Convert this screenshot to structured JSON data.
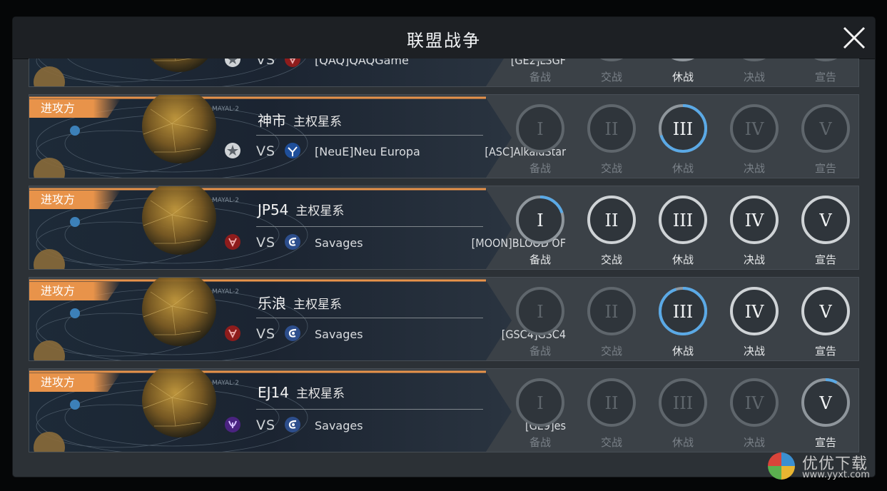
{
  "header": {
    "title": "联盟战争"
  },
  "stage_colors": {
    "dim": "#5f666c",
    "lit": "#cfd3d6",
    "progress": "#5aa9e6",
    "banner": "#e8934a"
  },
  "partial_row": {
    "alliance_a": "[GE2]LSGF",
    "vs": "VS",
    "alliance_b": "[QAQ]QAQGame",
    "stages": [
      {
        "label": "备战",
        "lit": false
      },
      {
        "label": "交战",
        "lit": false
      },
      {
        "label": "休战",
        "lit": true
      },
      {
        "label": "决战",
        "lit": false
      },
      {
        "label": "宣告",
        "lit": false
      }
    ]
  },
  "rows": [
    {
      "tag": "进攻方",
      "system_name": "神市",
      "system_type": "主权星系",
      "alliance_a": "[ASC]AlkaidStar",
      "emblem_a": "star-emblem-icon",
      "vs": "VS",
      "alliance_b": "[NeuE]Neu Europa",
      "emblem_b": "blue-emblem-icon",
      "current_stage": 3,
      "stage_progress": 0.7,
      "stages": [
        {
          "numeral": "I",
          "label": "备战",
          "lit": false
        },
        {
          "numeral": "II",
          "label": "交战",
          "lit": false
        },
        {
          "numeral": "III",
          "label": "休战",
          "lit": true
        },
        {
          "numeral": "IV",
          "label": "决战",
          "lit": false
        },
        {
          "numeral": "V",
          "label": "宣告",
          "lit": false
        }
      ]
    },
    {
      "tag": "进攻方",
      "system_name": "JP54",
      "system_type": "主权星系",
      "alliance_a": "[MOON]BLOOD OF",
      "emblem_a": "red-emblem-icon",
      "vs": "VS",
      "alliance_b": "Savages",
      "emblem_b": "savages-emblem-icon",
      "current_stage": 1,
      "stage_progress": 0.2,
      "stages": [
        {
          "numeral": "I",
          "label": "备战",
          "lit": false
        },
        {
          "numeral": "II",
          "label": "交战",
          "lit": true
        },
        {
          "numeral": "III",
          "label": "休战",
          "lit": true
        },
        {
          "numeral": "IV",
          "label": "决战",
          "lit": true
        },
        {
          "numeral": "V",
          "label": "宣告",
          "lit": true
        }
      ]
    },
    {
      "tag": "进攻方",
      "system_name": "乐浪",
      "system_type": "主权星系",
      "alliance_a": "[GSC4]GSC4",
      "emblem_a": "red-emblem-icon",
      "vs": "VS",
      "alliance_b": "Savages",
      "emblem_b": "savages-emblem-icon",
      "current_stage": 3,
      "stage_progress": 0.95,
      "stages": [
        {
          "numeral": "I",
          "label": "备战",
          "lit": false
        },
        {
          "numeral": "II",
          "label": "交战",
          "lit": false
        },
        {
          "numeral": "III",
          "label": "休战",
          "lit": false
        },
        {
          "numeral": "IV",
          "label": "决战",
          "lit": true
        },
        {
          "numeral": "V",
          "label": "宣告",
          "lit": true
        }
      ]
    },
    {
      "tag": "进攻方",
      "system_name": "EJ14",
      "system_type": "主权星系",
      "alliance_a": "[GE9]es",
      "emblem_a": "purple-emblem-icon",
      "vs": "VS",
      "alliance_b": "Savages",
      "emblem_b": "savages-emblem-icon",
      "current_stage": 5,
      "stage_progress": 0.08,
      "stages": [
        {
          "numeral": "I",
          "label": "备战",
          "lit": false
        },
        {
          "numeral": "II",
          "label": "交战",
          "lit": false
        },
        {
          "numeral": "III",
          "label": "休战",
          "lit": false
        },
        {
          "numeral": "IV",
          "label": "决战",
          "lit": false
        },
        {
          "numeral": "V",
          "label": "宣告",
          "lit": true
        }
      ]
    }
  ],
  "watermark": {
    "text": "优优下载",
    "url": "www.yyxt.com"
  }
}
